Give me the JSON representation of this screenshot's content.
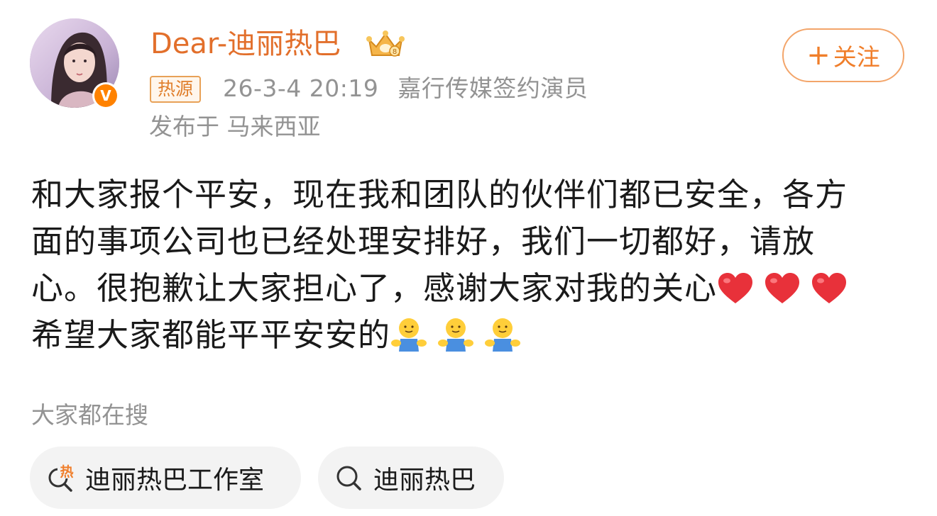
{
  "user": {
    "name": "Dear-迪丽热巴",
    "verified_icon": "verified-v-icon",
    "verified_letter": "V",
    "crown_icon": "vip-crown-icon"
  },
  "post": {
    "source_tag": "热源",
    "timestamp": "26-3-4 20:19",
    "author_bio": "嘉行传媒签约演员",
    "location": "发布于 马来西亚",
    "body_lines": [
      "和大家报个平安，现在我和团队的伙伴们都已安全，各方",
      "面的事项公司也已经处理安排好，我们一切都好，请放",
      "心。很抱歉让大家担心了，感谢大家对我的关心",
      "希望大家都能平平安安的"
    ],
    "emojis": {
      "heart": "red-heart-icon",
      "hug": "hug-emoji-icon"
    }
  },
  "follow": {
    "plus": "+",
    "label": "关注"
  },
  "trending": {
    "title": "大家都在搜",
    "items": [
      {
        "label": "迪丽热巴工作室",
        "icon": "hot-search-icon",
        "hot_mark": "热"
      },
      {
        "label": "迪丽热巴",
        "icon": "search-icon"
      }
    ]
  },
  "colors": {
    "accent": "#e26f2b",
    "meta_gray": "#939393",
    "verified_orange": "#ff8200",
    "chip_bg": "#f3f3f3"
  }
}
